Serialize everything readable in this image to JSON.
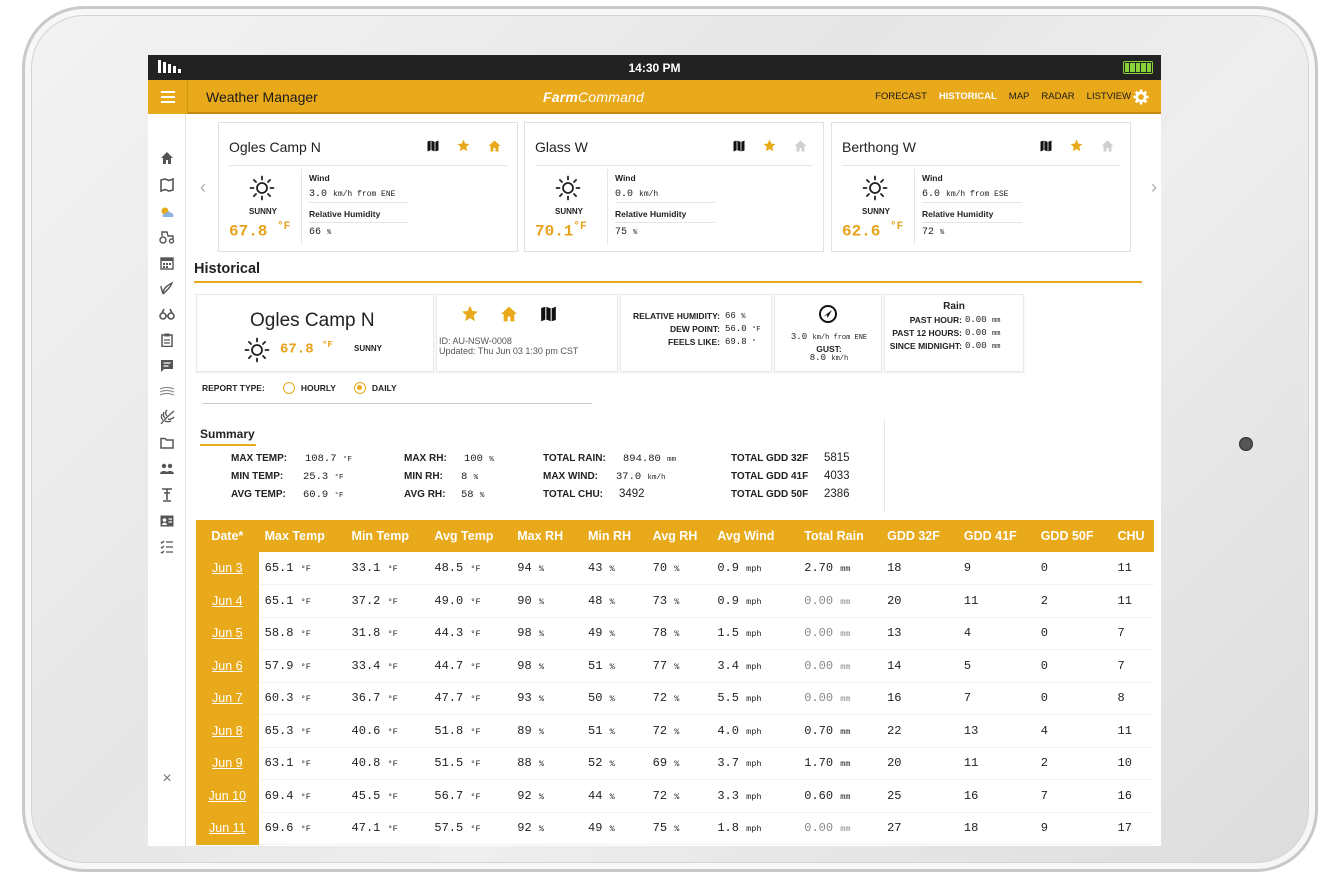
{
  "status_bar": {
    "time": "14:30 PM"
  },
  "app_bar": {
    "title": "Weather Manager",
    "brand_bold": "Farm",
    "brand_rest": "Command",
    "nav": [
      "FORECAST",
      "HISTORICAL",
      "MAP",
      "RADAR",
      "LISTVIEW"
    ],
    "active_nav": "HISTORICAL"
  },
  "rail_icons": [
    "home-icon",
    "map-icon",
    "weather-icon",
    "tractor-icon",
    "calendar-icon",
    "sprout-icon",
    "binoculars-icon",
    "clipboard-icon",
    "chat-icon",
    "field-icon",
    "crop-icon",
    "folder-icon",
    "users-icon",
    "scale-icon",
    "contact-card-icon",
    "checklist-icon",
    "close-icon"
  ],
  "stations": [
    {
      "name": "Ogles Camp N",
      "cond": "SUNNY",
      "temp": "67.8",
      "temp_unit": "°F",
      "wind_label": "Wind",
      "wind_value": "3.0",
      "wind_unit": "km/h from ENE",
      "rh_label": "Relative Humidity",
      "rh_value": "66",
      "rh_unit": "%"
    },
    {
      "name": "Glass W",
      "cond": "SUNNY",
      "temp": "70.1",
      "temp_unit": "°F",
      "wind_label": "Wind",
      "wind_value": "0.0",
      "wind_unit": "km/h",
      "rh_label": "Relative Humidity",
      "rh_value": "75",
      "rh_unit": "%"
    },
    {
      "name": "Berthong W",
      "cond": "SUNNY",
      "temp": "62.6",
      "temp_unit": "°F",
      "wind_label": "Wind",
      "wind_value": "6.0",
      "wind_unit": "km/h from ESE",
      "rh_label": "Relative Humidity",
      "rh_value": "72",
      "rh_unit": "%"
    }
  ],
  "historical": {
    "title": "Historical",
    "station": {
      "name": "Ogles Camp N",
      "temp": "67.8",
      "temp_unit": "°F",
      "cond": "SUNNY",
      "id": "ID: AU-NSW-0008",
      "updated": "Updated: Thu Jun 03 1:30 pm CST"
    },
    "conditions": {
      "rh_label": "RELATIVE HUMIDITY:",
      "rh_value": "66",
      "rh_unit": "%",
      "dew_label": "DEW POINT:",
      "dew_value": "56.0",
      "dew_unit": "°F",
      "feels_label": "FEELS LIKE:",
      "feels_value": "69.8",
      "feels_unit": "°"
    },
    "wind": {
      "value": "3.0",
      "unit": "km/h from ENE",
      "gust_label": "GUST:",
      "gust_value": "8.0",
      "gust_unit": "km/h"
    },
    "rain": {
      "title": "Rain",
      "past_hour_label": "PAST HOUR:",
      "past_hour_value": "0.00",
      "past_hour_unit": "mm",
      "past12_label": "PAST 12 HOURS:",
      "past12_value": "0.00",
      "past12_unit": "mm",
      "midnight_label": "SINCE MIDNIGHT:",
      "midnight_value": "0.00",
      "midnight_unit": "mm"
    },
    "report": {
      "label": "REPORT TYPE:",
      "options": [
        "HOURLY",
        "DAILY"
      ],
      "selected": "DAILY"
    },
    "summary": {
      "title": "Summary",
      "max_temp_label": "MAX TEMP:",
      "max_temp": "108.7",
      "min_temp_label": "MIN TEMP:",
      "min_temp": "25.3",
      "avg_temp_label": "AVG TEMP:",
      "avg_temp": "60.9",
      "temp_unit": "°F",
      "max_rh_label": "MAX RH:",
      "max_rh": "100",
      "min_rh_label": "MIN RH:",
      "min_rh": "8",
      "avg_rh_label": "AVG RH:",
      "avg_rh": "58",
      "rh_unit": "%",
      "total_rain_label": "TOTAL RAIN:",
      "total_rain": "894.80",
      "rain_unit": "mm",
      "max_wind_label": "MAX WIND:",
      "max_wind": "37.0",
      "wind_unit": "km/h",
      "total_chu_label": "TOTAL CHU:",
      "total_chu": "3492",
      "gdd32_label": "TOTAL GDD 32F",
      "gdd32": "5815",
      "gdd41_label": "TOTAL GDD 41F",
      "gdd41": "4033",
      "gdd50_label": "TOTAL GDD 50F",
      "gdd50": "2386"
    },
    "table": {
      "headers": [
        "Date*",
        "Max Temp",
        "Min Temp",
        "Avg Temp",
        "Max RH",
        "Min RH",
        "Avg RH",
        "Avg Wind",
        "Total Rain",
        "GDD 32F",
        "GDD 41F",
        "GDD 50F",
        "CHU"
      ],
      "temp_unit": "°F",
      "rh_unit": "%",
      "wind_unit": "mph",
      "rain_unit": "mm",
      "rows": [
        [
          "Jun 3",
          "65.1",
          "33.1",
          "48.5",
          "94",
          "43",
          "70",
          "0.9",
          "2.70",
          "18",
          "9",
          "0",
          "11"
        ],
        [
          "Jun 4",
          "65.1",
          "37.2",
          "49.0",
          "90",
          "48",
          "73",
          "0.9",
          "0.00",
          "20",
          "11",
          "2",
          "11"
        ],
        [
          "Jun 5",
          "58.8",
          "31.8",
          "44.3",
          "98",
          "49",
          "78",
          "1.5",
          "0.00",
          "13",
          "4",
          "0",
          "7"
        ],
        [
          "Jun 6",
          "57.9",
          "33.4",
          "44.7",
          "98",
          "51",
          "77",
          "3.4",
          "0.00",
          "14",
          "5",
          "0",
          "7"
        ],
        [
          "Jun 7",
          "60.3",
          "36.7",
          "47.7",
          "93",
          "50",
          "72",
          "5.5",
          "0.00",
          "16",
          "7",
          "0",
          "8"
        ],
        [
          "Jun 8",
          "65.3",
          "40.6",
          "51.8",
          "89",
          "51",
          "72",
          "4.0",
          "0.70",
          "22",
          "13",
          "4",
          "11"
        ],
        [
          "Jun 9",
          "63.1",
          "40.8",
          "51.5",
          "88",
          "52",
          "69",
          "3.7",
          "1.70",
          "20",
          "11",
          "2",
          "10"
        ],
        [
          "Jun 10",
          "69.4",
          "45.5",
          "56.7",
          "92",
          "44",
          "72",
          "3.3",
          "0.60",
          "25",
          "16",
          "7",
          "16"
        ],
        [
          "Jun 11",
          "69.6",
          "47.1",
          "57.5",
          "92",
          "49",
          "75",
          "1.8",
          "0.00",
          "27",
          "18",
          "9",
          "17"
        ]
      ]
    }
  },
  "colors": {
    "accent": "#e8a91a",
    "statusbar": "#222222",
    "battery": "#8bd23a"
  }
}
